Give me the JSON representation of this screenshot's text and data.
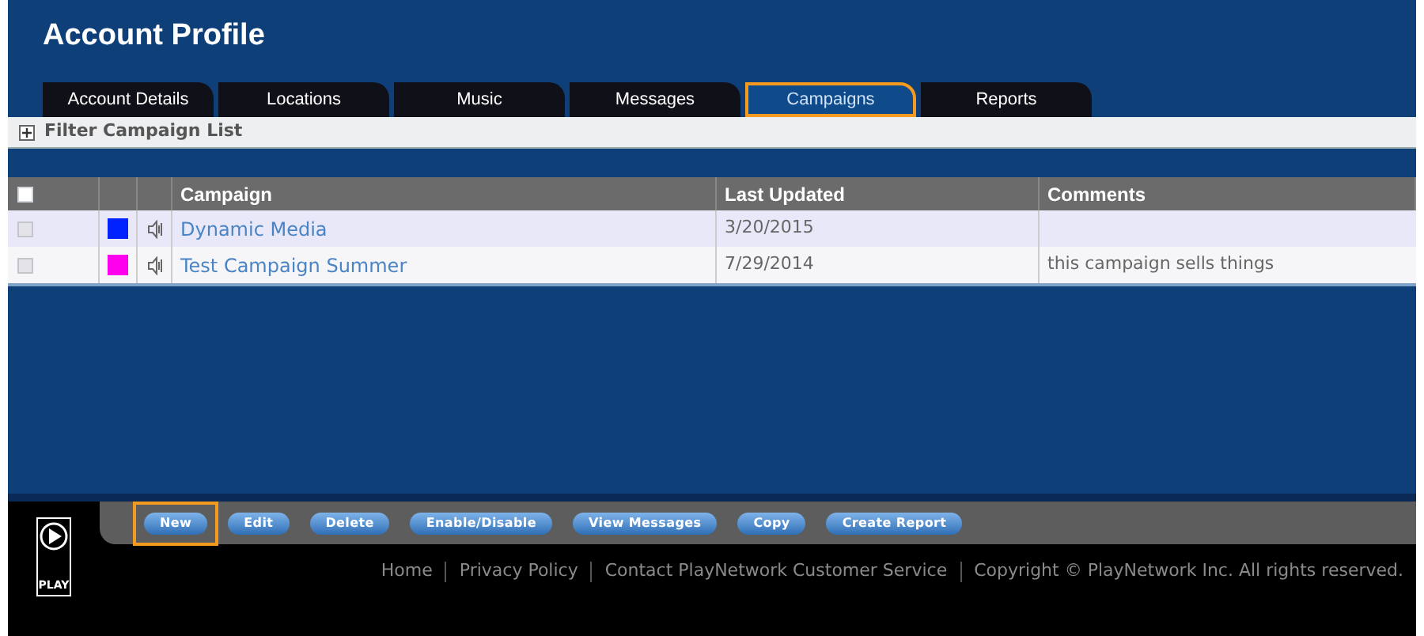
{
  "title": "Account Profile",
  "tabs": [
    {
      "label": "Account Details",
      "selected": false
    },
    {
      "label": "Locations",
      "selected": false
    },
    {
      "label": "Music",
      "selected": false
    },
    {
      "label": "Messages",
      "selected": false
    },
    {
      "label": "Campaigns",
      "selected": true
    },
    {
      "label": "Reports",
      "selected": false
    }
  ],
  "filter": {
    "label": "Filter Campaign List",
    "expanded": false
  },
  "table": {
    "select_all_checked": false,
    "columns": [
      "Campaign",
      "Last Updated",
      "Comments"
    ],
    "rows": [
      {
        "checked": false,
        "color": "#0022ff",
        "campaign": "Dynamic Media",
        "last_updated": "3/20/2015",
        "comments": ""
      },
      {
        "checked": false,
        "color": "#ff00ee",
        "campaign": "Test Campaign Summer",
        "last_updated": "7/29/2014",
        "comments": "this campaign sells things"
      }
    ]
  },
  "logo": {
    "text": "PLAY"
  },
  "buttons": [
    {
      "label": "New",
      "highlighted": true
    },
    {
      "label": "Edit",
      "highlighted": false
    },
    {
      "label": "Delete",
      "highlighted": false
    },
    {
      "label": "Enable/Disable",
      "highlighted": false
    },
    {
      "label": "View Messages",
      "highlighted": false
    },
    {
      "label": "Copy",
      "highlighted": false
    },
    {
      "label": "Create Report",
      "highlighted": false
    }
  ],
  "footer_links": [
    "Home",
    "Privacy Policy",
    "Contact PlayNetwork Customer Service",
    "Copyright © PlayNetwork Inc. All rights reserved."
  ]
}
